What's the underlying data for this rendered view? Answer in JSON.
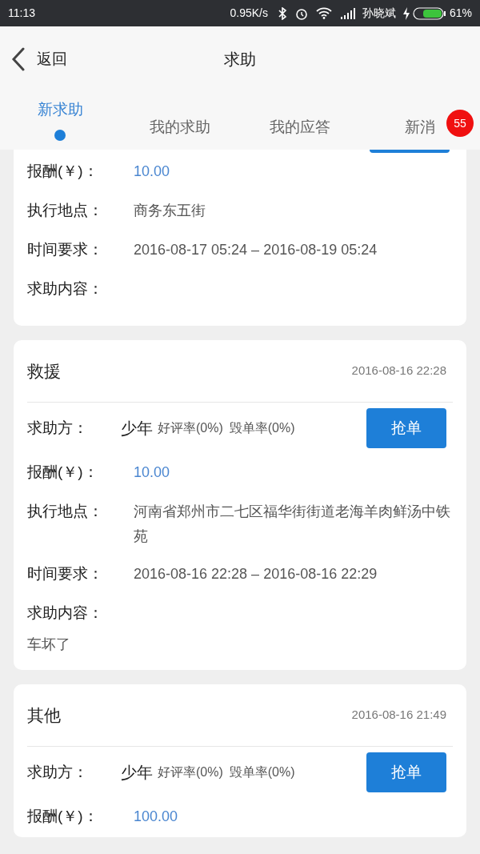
{
  "status_bar": {
    "time": "11:13",
    "speed": "0.95K/s",
    "carrier": "孙晓斌",
    "battery_text": "61%"
  },
  "header": {
    "back": "返回",
    "title": "求助"
  },
  "tabs": [
    {
      "label": "新求助",
      "selected": true
    },
    {
      "label": "我的求助",
      "selected": false
    },
    {
      "label": "我的应答",
      "selected": false
    },
    {
      "label": "新消",
      "selected": false,
      "badge": "55"
    }
  ],
  "cards": [
    {
      "kind": "cut_off",
      "fields": [
        {
          "label": "报酬(￥)：",
          "value": "10.00",
          "kind": "amount"
        },
        {
          "label": "执行地点：",
          "value": "商务东五街",
          "kind": "text"
        },
        {
          "label": "时间要求：",
          "value": "2016-08-17 05:24  –  2016-08-19 05:24",
          "kind": "text"
        },
        {
          "label": "求助内容："
        }
      ]
    },
    {
      "kind": "full",
      "category": "救援",
      "time": "2016-08-16 22:28",
      "requester_label": "求助方：",
      "requester": "少年",
      "good_rate": "好评率(0%)",
      "bad_rate": "毁单率(0%)",
      "button": "抢单",
      "fields": [
        {
          "label": "报酬(￥)：",
          "value": "10.00",
          "kind": "amount"
        },
        {
          "label": "执行地点：",
          "value": "河南省郑州市二七区福华街街道老海羊肉鲜汤中铁苑",
          "kind": "text"
        },
        {
          "label": "时间要求：",
          "value": "2016-08-16 22:28  –  2016-08-16 22:29",
          "kind": "text"
        },
        {
          "label": "求助内容："
        }
      ],
      "content": "车坏了"
    },
    {
      "kind": "full",
      "category": "其他",
      "time": "2016-08-16 21:49",
      "requester_label": "求助方：",
      "requester": "少年",
      "good_rate": "好评率(0%)",
      "bad_rate": "毁单率(0%)",
      "button": "抢单",
      "fields": [
        {
          "label": "报酬(￥)：",
          "value": "100.00",
          "kind": "amount"
        }
      ]
    }
  ]
}
